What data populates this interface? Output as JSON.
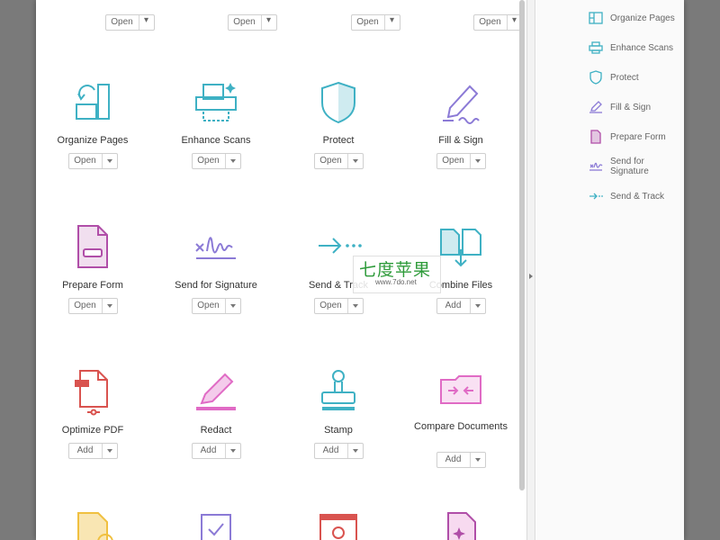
{
  "top_row": {
    "button_label": "Open"
  },
  "tools": [
    {
      "label": "Organize Pages",
      "button": "Open"
    },
    {
      "label": "Enhance Scans",
      "button": "Open"
    },
    {
      "label": "Protect",
      "button": "Open"
    },
    {
      "label": "Fill & Sign",
      "button": "Open"
    },
    {
      "label": "Prepare Form",
      "button": "Open"
    },
    {
      "label": "Send for Signature",
      "button": "Open"
    },
    {
      "label": "Send & Track",
      "button": "Open"
    },
    {
      "label": "Combine Files",
      "button": "Add"
    },
    {
      "label": "Optimize PDF",
      "button": "Add"
    },
    {
      "label": "Redact",
      "button": "Add"
    },
    {
      "label": "Stamp",
      "button": "Add"
    },
    {
      "label": "Compare Documents",
      "button": "Add"
    }
  ],
  "sidebar": {
    "items": [
      {
        "label": "Organize Pages"
      },
      {
        "label": "Enhance Scans"
      },
      {
        "label": "Protect"
      },
      {
        "label": "Fill & Sign"
      },
      {
        "label": "Prepare Form"
      },
      {
        "label": "Send for Signature"
      },
      {
        "label": "Send & Track"
      }
    ]
  },
  "watermark": {
    "text": "七度苹果",
    "url": "www.7do.net"
  },
  "colors": {
    "teal": "#3fb1c4",
    "purple": "#8b7ad6",
    "magenta": "#b04ea8",
    "red": "#d9534f",
    "pink": "#e06bc5",
    "green": "#2e9b3a",
    "yellow": "#f0c040"
  }
}
